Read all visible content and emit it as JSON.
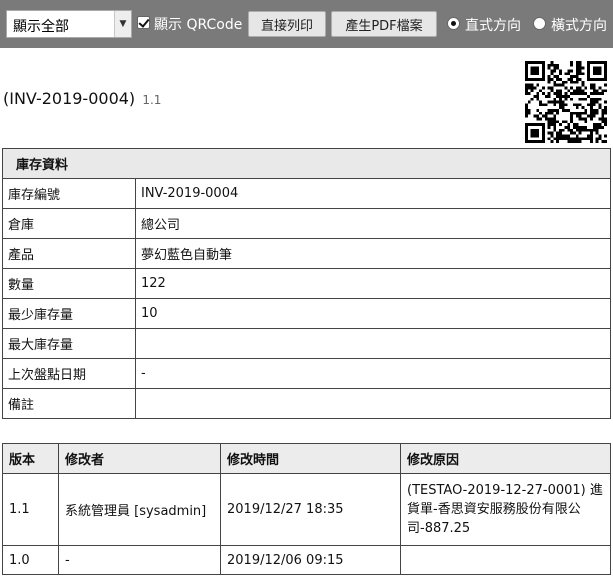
{
  "toolbar": {
    "filter_select": "顯示全部",
    "show_qrcode_label": "顯示 QRCode",
    "show_qrcode_checked": true,
    "print_label": "直接列印",
    "pdf_label": "產生PDF檔案",
    "portrait_label": "直式方向",
    "landscape_label": "橫式方向",
    "orientation": "portrait"
  },
  "header": {
    "doc_id": "(INV-2019-0004)",
    "version": "1.1"
  },
  "inventory": {
    "section_title": "庫存資料",
    "rows": [
      {
        "label": "庫存編號",
        "value": "INV-2019-0004"
      },
      {
        "label": "倉庫",
        "value": "總公司"
      },
      {
        "label": "產品",
        "value": "夢幻藍色自動筆"
      },
      {
        "label": "數量",
        "value": "122"
      },
      {
        "label": "最少庫存量",
        "value": "10"
      },
      {
        "label": "最大庫存量",
        "value": ""
      },
      {
        "label": "上次盤點日期",
        "value": "-"
      },
      {
        "label": "備註",
        "value": ""
      }
    ]
  },
  "history": {
    "columns": [
      "版本",
      "修改者",
      "修改時間",
      "修改原因"
    ],
    "rows": [
      {
        "version": "1.1",
        "editor": "系統管理員 [sysadmin]",
        "time": "2019/12/27 18:35",
        "reason": "(TESTAO-2019-12-27-0001) 進貨單-香思資安服務股份有限公司-887.25"
      },
      {
        "version": "1.0",
        "editor": "-",
        "time": "2019/12/06 09:15",
        "reason": ""
      }
    ]
  }
}
